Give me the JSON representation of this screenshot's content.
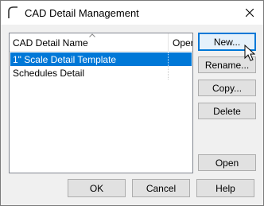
{
  "window": {
    "title": "CAD Detail Management",
    "icon": "cad-detail-app-icon",
    "close_icon": "close-icon"
  },
  "list": {
    "columns": [
      "CAD Detail Name",
      "Open"
    ],
    "rows": [
      {
        "name": "1\" Scale Detail Template",
        "open": "",
        "selected": true
      },
      {
        "name": "Schedules Detail",
        "open": "",
        "selected": false
      }
    ]
  },
  "side_buttons": {
    "new": "New...",
    "rename": "Rename...",
    "copy": "Copy...",
    "delete": "Delete",
    "open": "Open"
  },
  "footer_buttons": {
    "ok": "OK",
    "cancel": "Cancel",
    "help": "Help"
  },
  "colors": {
    "selection": "#0078d7",
    "accent_border": "#0078d7",
    "button_bg": "#e1e1e1"
  }
}
